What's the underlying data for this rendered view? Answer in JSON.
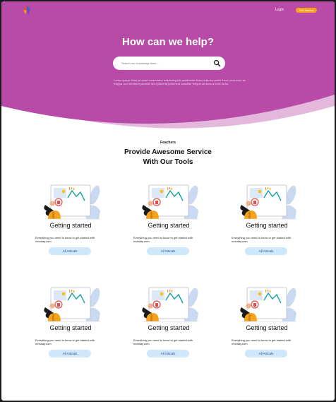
{
  "header": {
    "login_label": "Login",
    "cta_label": "Get Started"
  },
  "hero": {
    "title": "How can we help?",
    "search_placeholder": "Search our knowledge base...",
    "description": "Lorem ipsum dolor sit amet consectetur adipiscing elit vestibulum libero felis leo sociis fusce urna enim ac magna orci hendrerit pulvinar arcu placerat parturient nascetur tempor ultricies a nunc tortor."
  },
  "features": {
    "label": "Feachers",
    "title_line1": "Provide Awesome Service",
    "title_line2": "With Our Tools",
    "cards": [
      {
        "title": "Getting started",
        "description": "Everything you need to know to get started with monday.com",
        "button": "All Articals"
      },
      {
        "title": "Getting started",
        "description": "Everything you need to know to get started with monday.com",
        "button": "All Articals"
      },
      {
        "title": "Getting started",
        "description": "Everything you need to know to get started with monday.com",
        "button": "All Articals"
      },
      {
        "title": "Getting started",
        "description": "Everything you need to know to get started with monday.com",
        "button": "All Articals"
      },
      {
        "title": "Getting started",
        "description": "Everything you need to know to get started with monday.com",
        "button": "All Articals"
      },
      {
        "title": "Getting started",
        "description": "Everything you need to know to get started with monday.com",
        "button": "All Articals"
      }
    ]
  },
  "colors": {
    "hero_bg": "#b84aa8",
    "hero_wave_light": "#e4b8dc",
    "cta_orange": "#f7a21b",
    "button_blue": "#cfe7fb"
  }
}
